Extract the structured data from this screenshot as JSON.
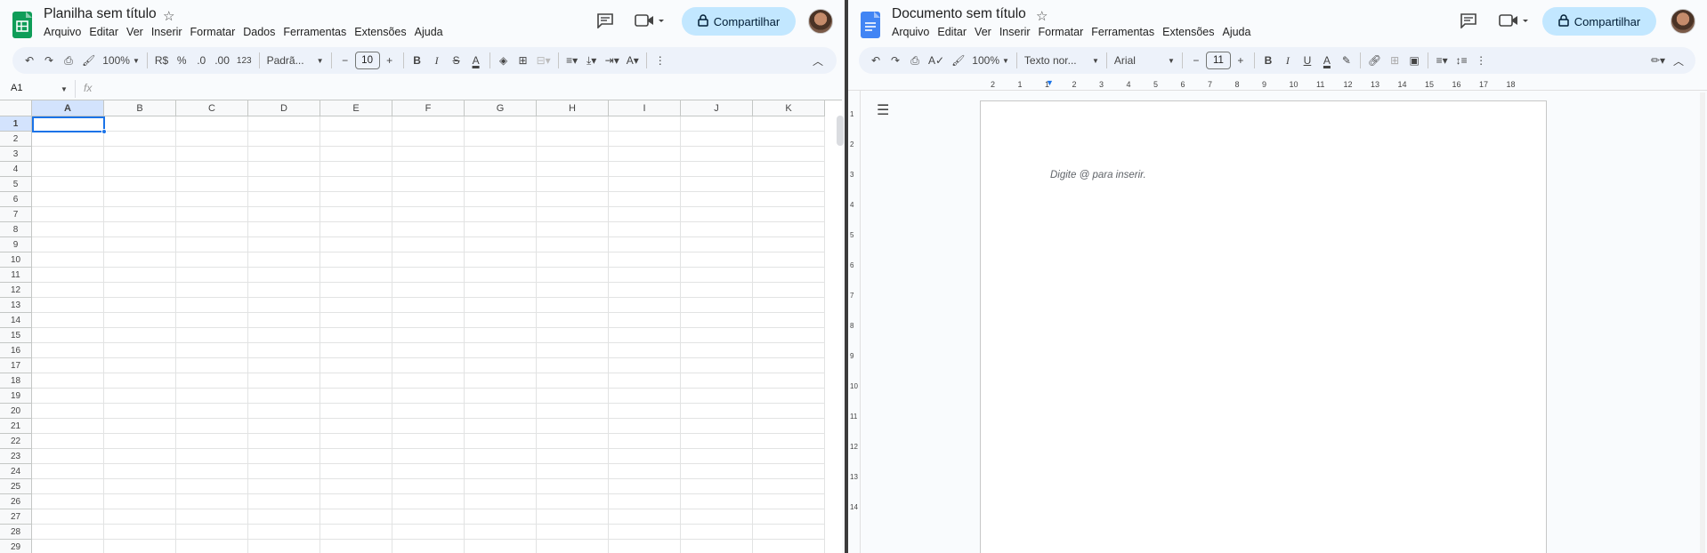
{
  "sheets": {
    "title": "Planilha sem título",
    "menu": [
      "Arquivo",
      "Editar",
      "Ver",
      "Inserir",
      "Formatar",
      "Dados",
      "Ferramentas",
      "Extensões",
      "Ajuda"
    ],
    "share_label": "Compartilhar",
    "toolbar": {
      "zoom": "100%",
      "currency": "R$",
      "percent": "%",
      "dec_minus": ".0",
      "dec_plus": ".00",
      "format_123": "123",
      "font": "Padrã...",
      "font_size": "10"
    },
    "namebox": "A1",
    "fx": "fx",
    "columns": [
      "A",
      "B",
      "C",
      "D",
      "E",
      "F",
      "G",
      "H",
      "I",
      "J",
      "K"
    ],
    "rows": [
      "1",
      "2",
      "3",
      "4",
      "5",
      "6",
      "7",
      "8",
      "9",
      "10",
      "11",
      "12",
      "13",
      "14",
      "15",
      "16",
      "17",
      "18",
      "19",
      "20",
      "21",
      "22",
      "23",
      "24",
      "25",
      "26",
      "27",
      "28",
      "29"
    ]
  },
  "docs": {
    "title": "Documento sem título",
    "menu": [
      "Arquivo",
      "Editar",
      "Ver",
      "Inserir",
      "Formatar",
      "Ferramentas",
      "Extensões",
      "Ajuda"
    ],
    "share_label": "Compartilhar",
    "toolbar": {
      "zoom": "100%",
      "style": "Texto nor...",
      "font": "Arial",
      "font_size": "11"
    },
    "ruler": [
      "2",
      "1",
      "1",
      "2",
      "3",
      "4",
      "5",
      "6",
      "7",
      "8",
      "9",
      "10",
      "11",
      "12",
      "13",
      "14",
      "15",
      "16",
      "17",
      "18"
    ],
    "vruler": [
      "1",
      "2",
      "3",
      "4",
      "5",
      "6",
      "7",
      "8",
      "9",
      "10",
      "11",
      "12",
      "13",
      "14"
    ],
    "placeholder": "Digite @ para inserir."
  },
  "colors": {
    "accent": "#1a73e8",
    "share_bg": "#c2e7ff",
    "toolbar_bg": "#edf2fa",
    "sheets_green": "#0f9d58",
    "docs_blue": "#4285f4"
  }
}
